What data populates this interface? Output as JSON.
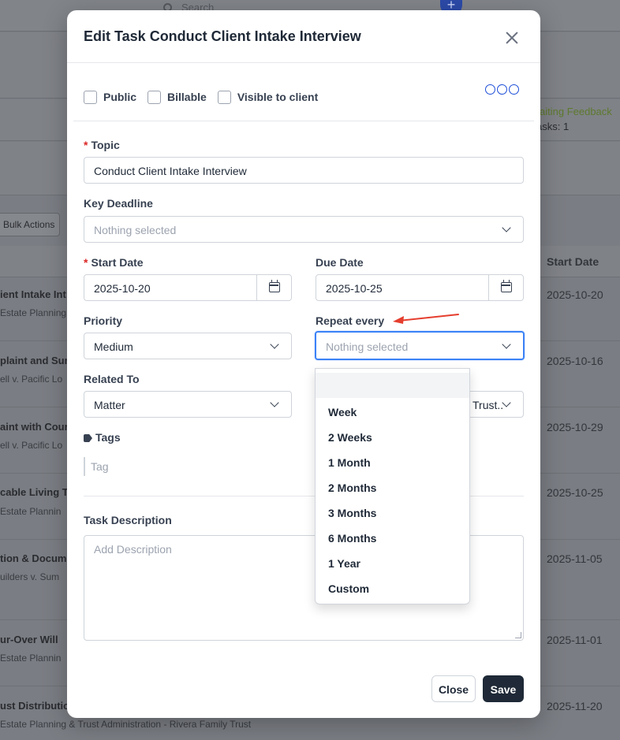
{
  "background": {
    "search_placeholder": "Search",
    "plus_label": "+",
    "status_awaiting": "aiting Feedback",
    "status_tasks": "asks: 1",
    "bulk_actions": "Bulk Actions",
    "col_start_date": "Start Date",
    "rows": [
      {
        "title": "ient Intake Int",
        "sub": "Estate Planning",
        "date": "2025-10-20"
      },
      {
        "title": "plaint and Sum",
        "sub": "ell v. Pacific Lo",
        "date": "2025-10-16"
      },
      {
        "title": "aint with Cour",
        "sub": "ell v. Pacific Lo",
        "date": "2025-10-29"
      },
      {
        "title": "cable Living T",
        "sub": "Estate Plannin",
        "date": "2025-10-25"
      },
      {
        "title": "tion & Docum",
        "sub": "uilders v. Sum",
        "date": "2025-11-05"
      },
      {
        "title": "ur-Over Will",
        "sub": "Estate Plannin",
        "date": "2025-11-01"
      },
      {
        "title": "ust Distributio",
        "sub": "Estate Planning & Trust Administration - Rivera Family Trust",
        "date": "2025-11-20"
      }
    ]
  },
  "modal": {
    "title": "Edit Task Conduct Client Intake Interview",
    "checkboxes": {
      "public": "Public",
      "billable": "Billable",
      "visible_to_client": "Visible to client"
    },
    "required_mark": "*",
    "topic": {
      "label": "Topic",
      "value": "Conduct Client Intake Interview"
    },
    "key_deadline": {
      "label": "Key Deadline",
      "placeholder": "Nothing selected"
    },
    "start_date": {
      "label": "Start Date",
      "value": "2025-10-20"
    },
    "due_date": {
      "label": "Due Date",
      "value": "2025-10-25"
    },
    "priority": {
      "label": "Priority",
      "value": "Medium"
    },
    "repeat_every": {
      "label": "Repeat every",
      "placeholder": "Nothing selected",
      "options": [
        "",
        "Week",
        "2 Weeks",
        "1 Month",
        "2 Months",
        "3 Months",
        "6 Months",
        "1 Year",
        "Custom"
      ]
    },
    "related_to": {
      "label": "Related To",
      "value": "Matter",
      "related_value": "Trust.."
    },
    "tags": {
      "label": "Tags",
      "placeholder": "Tag"
    },
    "task_description": {
      "label": "Task Description",
      "placeholder": "Add Description"
    },
    "buttons": {
      "close": "Close",
      "save": "Save"
    }
  },
  "colors": {
    "accent": "#3b82f6",
    "primary_button": "#1f2937",
    "required": "#dc2626",
    "annotation_arrow": "#e53e2e"
  }
}
